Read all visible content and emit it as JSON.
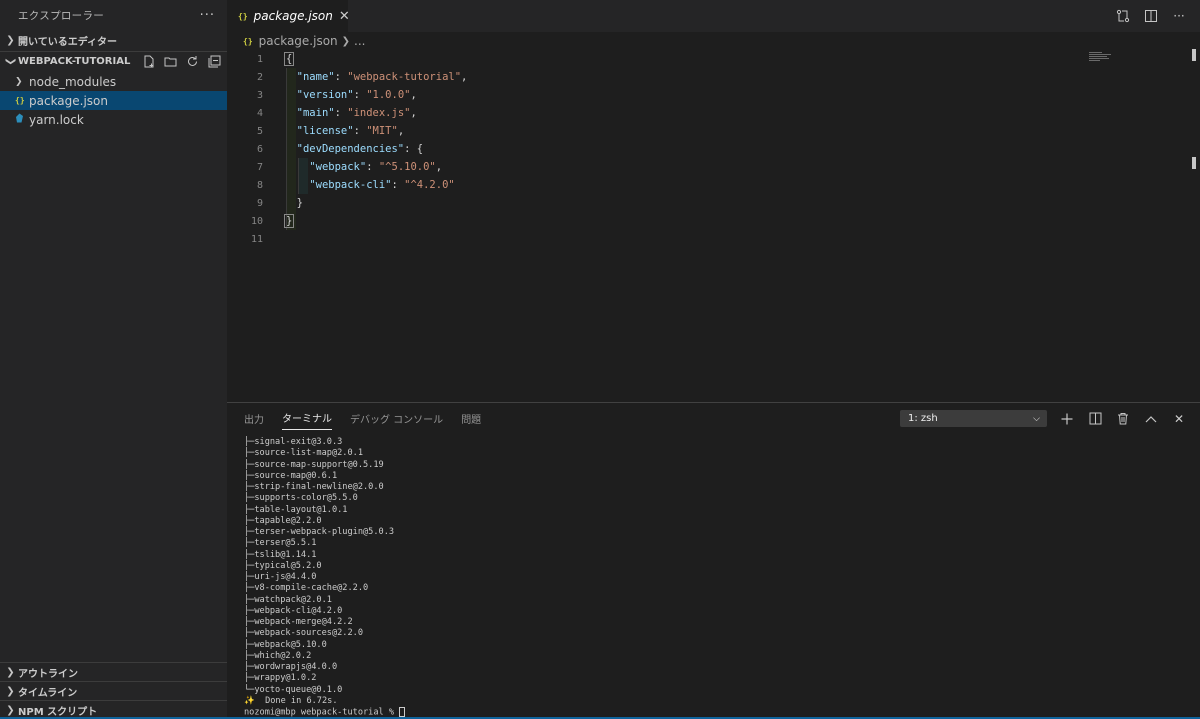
{
  "sidebar": {
    "title": "エクスプローラー",
    "more_label": "···",
    "open_editors_label": "開いているエディター",
    "project_label": "WEBPACK-TUTORIAL",
    "items": [
      {
        "label": "node_modules"
      },
      {
        "label": "package.json"
      },
      {
        "label": "yarn.lock"
      }
    ],
    "bottom_sections": [
      {
        "label": "アウトライン"
      },
      {
        "label": "タイムライン"
      },
      {
        "label": "NPM スクリプト"
      }
    ]
  },
  "editor": {
    "tab_label": "package.json",
    "json_icon_label": "{}",
    "breadcrumb": {
      "file": "package.json",
      "more": "..."
    },
    "line_numbers": [
      "1",
      "2",
      "3",
      "4",
      "5",
      "6",
      "7",
      "8",
      "9",
      "10",
      "11"
    ],
    "code": {
      "name_key": "\"name\"",
      "name_val": "\"webpack-tutorial\"",
      "version_key": "\"version\"",
      "version_val": "\"1.0.0\"",
      "main_key": "\"main\"",
      "main_val": "\"index.js\"",
      "license_key": "\"license\"",
      "license_val": "\"MIT\"",
      "dev_key": "\"devDependencies\"",
      "webpack_key": "\"webpack\"",
      "webpack_val": "\"^5.10.0\"",
      "cli_key": "\"webpack-cli\"",
      "cli_val": "\"^4.2.0\""
    }
  },
  "panel": {
    "tabs": [
      "出力",
      "ターミナル",
      "デバッグ コンソール",
      "問題"
    ],
    "active_tab": "ターミナル",
    "terminal_select": "1: zsh",
    "terminal_lines": [
      "├─signal-exit@3.0.3",
      "├─source-list-map@2.0.1",
      "├─source-map-support@0.5.19",
      "├─source-map@0.6.1",
      "├─strip-final-newline@2.0.0",
      "├─supports-color@5.5.0",
      "├─table-layout@1.0.1",
      "├─tapable@2.2.0",
      "├─terser-webpack-plugin@5.0.3",
      "├─terser@5.5.1",
      "├─tslib@1.14.1",
      "├─typical@5.2.0",
      "├─uri-js@4.4.0",
      "├─v8-compile-cache@2.2.0",
      "├─watchpack@2.0.1",
      "├─webpack-cli@4.2.0",
      "├─webpack-merge@4.2.2",
      "├─webpack-sources@2.2.0",
      "├─webpack@5.10.0",
      "├─which@2.0.2",
      "├─wordwrapjs@4.0.0",
      "├─wrappy@1.0.2",
      "└─yocto-queue@0.1.0"
    ],
    "done_text": "Done in 6.72s.",
    "prompt": "nozomi@mbp webpack-tutorial % "
  },
  "colors": {
    "accent": "#094771",
    "status_bar": "#0e639c",
    "json_icon": "#cbcb41"
  }
}
